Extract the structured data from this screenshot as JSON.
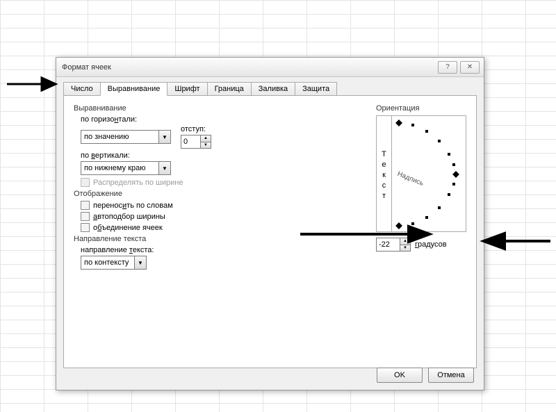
{
  "dialog": {
    "title": "Формат ячеек"
  },
  "tabs": [
    "Число",
    "Выравнивание",
    "Шрифт",
    "Граница",
    "Заливка",
    "Защита"
  ],
  "active_tab": 1,
  "align_group": "Выравнивание",
  "h_label_pre": "по горизо",
  "h_label_hot": "н",
  "h_label_post": "тали:",
  "h_value": "по значению",
  "indent_label": "отступ:",
  "indent_value": "0",
  "v_label_pre": "по ",
  "v_label_hot": "в",
  "v_label_post": "ертикали:",
  "v_value": "по нижнему краю",
  "distribute": "Распределять по ширине",
  "display_group": "Отображение",
  "wrap_pre": "перенос",
  "wrap_hot": "и",
  "wrap_post": "ть по словам",
  "autofit_hot": "а",
  "autofit_post": "втоподбор ширины",
  "merge_pre": "о",
  "merge_hot": "б",
  "merge_post": "ъединение ячеек",
  "dir_group": "Направление текста",
  "dir_label_pre": "направление ",
  "dir_label_hot": "т",
  "dir_label_post": "екста:",
  "dir_value": "по контексту",
  "orient_group": "Ориентация",
  "vertical_text": [
    "Т",
    "е",
    "к",
    "с",
    "т"
  ],
  "needle_text": "Надпись",
  "degrees_value": "-22",
  "degrees_label_hot": "г",
  "degrees_label_post": "радусов",
  "ok": "OK",
  "cancel": "Отмена"
}
